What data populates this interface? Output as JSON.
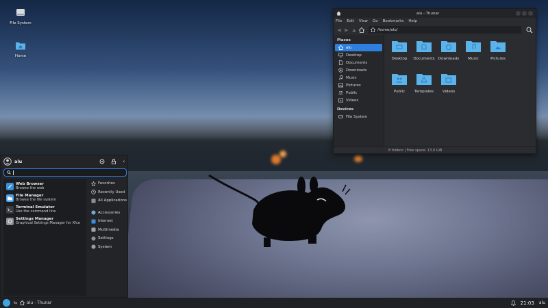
{
  "desktop": {
    "icons": [
      {
        "label": "File System",
        "icon": "drive-icon"
      },
      {
        "label": "Home",
        "icon": "home-folder-icon"
      }
    ]
  },
  "thunar": {
    "title": "alu - Thunar",
    "menu": [
      "File",
      "Edit",
      "View",
      "Go",
      "Bookmarks",
      "Help"
    ],
    "path": "/home/alu/",
    "sidebar": {
      "places_header": "Places",
      "places": [
        {
          "label": "alu",
          "icon": "home-icon",
          "active": true
        },
        {
          "label": "Desktop",
          "icon": "desktop-icon"
        },
        {
          "label": "Documents",
          "icon": "documents-icon"
        },
        {
          "label": "Downloads",
          "icon": "downloads-icon"
        },
        {
          "label": "Music",
          "icon": "music-icon"
        },
        {
          "label": "Pictures",
          "icon": "pictures-icon"
        },
        {
          "label": "Public",
          "icon": "public-icon"
        },
        {
          "label": "Videos",
          "icon": "videos-icon"
        }
      ],
      "devices_header": "Devices",
      "devices": [
        {
          "label": "File System",
          "icon": "drive-icon"
        }
      ]
    },
    "folders": [
      "Desktop",
      "Documents",
      "Downloads",
      "Music",
      "Pictures",
      "Public",
      "Templates",
      "Videos"
    ],
    "status": "8 folders  |  Free space: 13.0 GiB"
  },
  "whisker": {
    "user": "alu",
    "search_value": "",
    "favorites": [
      {
        "name": "Web Browser",
        "desc": "Browse the web",
        "color": "#3b8fd9"
      },
      {
        "name": "File Manager",
        "desc": "Browse the file system",
        "color": "#4aa3e8"
      },
      {
        "name": "Terminal Emulator",
        "desc": "Use the command line",
        "color": "#3a3d42"
      },
      {
        "name": "Settings Manager",
        "desc": "Graphical Settings Manager for Xfce",
        "color": "#8a8f98"
      }
    ],
    "categories": [
      "Favorites",
      "Recently Used",
      "All Applications",
      "Accessories",
      "Internet",
      "Multimedia",
      "Settings",
      "System"
    ]
  },
  "taskbar": {
    "task_label": "alu - Thunar",
    "clock": "21:03",
    "user": "alu"
  },
  "colors": {
    "accent": "#2f7fde",
    "folder": "#5bb3ea"
  }
}
